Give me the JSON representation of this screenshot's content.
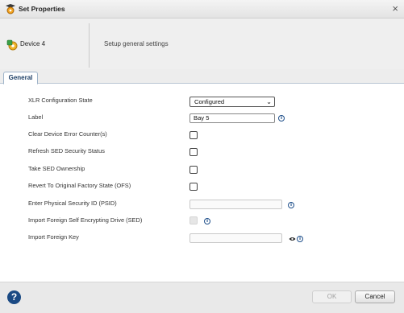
{
  "window": {
    "title": "Set Properties",
    "close_glyph": "×"
  },
  "header": {
    "device_name": "Device 4",
    "description": "Setup general settings"
  },
  "tabs": [
    {
      "label": "General",
      "active": true
    }
  ],
  "form": {
    "xlr_state": {
      "label": "XLR Configuration State",
      "value": "Configured"
    },
    "label_field": {
      "label": "Label",
      "value": "Bay 5"
    },
    "clear_errors": {
      "label": "Clear Device Error Counter(s)",
      "checked": false
    },
    "refresh_sed": {
      "label": "Refresh SED Security Status",
      "checked": false
    },
    "take_ownership": {
      "label": "Take SED Ownership",
      "checked": false
    },
    "revert_ofs": {
      "label": "Revert To Original Factory State (OFS)",
      "checked": false
    },
    "psid": {
      "label": "Enter Physical Security ID (PSID)",
      "value": ""
    },
    "import_sed": {
      "label": "Import Foreign Self Encrypting Drive (SED)",
      "checked": false,
      "disabled": true
    },
    "foreign_key": {
      "label": "Import Foreign Key",
      "value": ""
    }
  },
  "icons": {
    "info": "i",
    "help": "?",
    "chevron": "⌄"
  },
  "footer": {
    "ok_label": "OK",
    "cancel_label": "Cancel",
    "ok_disabled": true
  },
  "colors": {
    "accent": "#1b4a84",
    "tab_text": "#1d3f66",
    "header_bg": "#efefef",
    "footer_bg": "#e9e9e9"
  }
}
